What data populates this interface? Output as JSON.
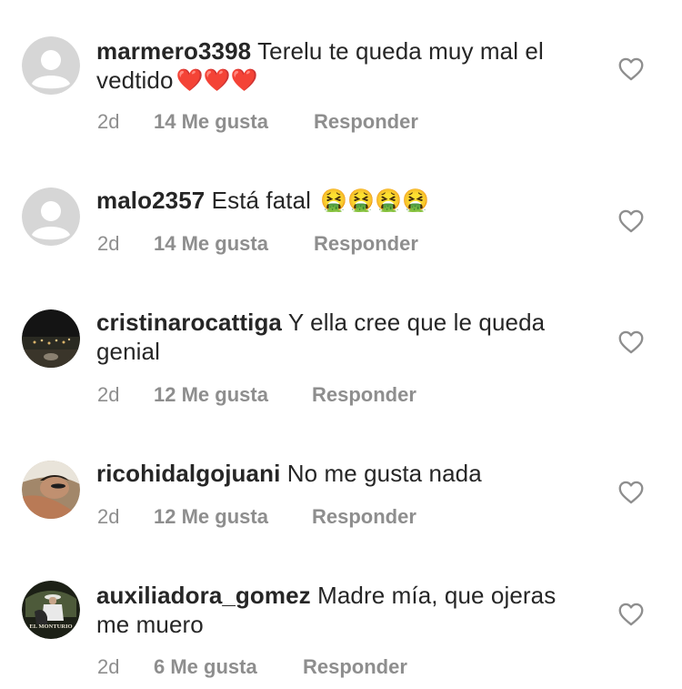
{
  "comments": [
    {
      "username": "marmero3398",
      "text": "Terelu te queda muy mal el vedtido",
      "emoji": "❤️❤️❤️",
      "time": "2d",
      "likes": "14 Me gusta",
      "reply": "Responder"
    },
    {
      "username": "malo2357",
      "text": "Está fatal",
      "emoji": "🤮🤮🤮🤮",
      "time": "2d",
      "likes": "14 Me gusta",
      "reply": "Responder"
    },
    {
      "username": "cristinarocattiga",
      "text": "Y ella cree que le queda genial",
      "emoji": "",
      "time": "2d",
      "likes": "12 Me gusta",
      "reply": "Responder"
    },
    {
      "username": "ricohidalgojuani",
      "text": "No me gusta nada",
      "emoji": "",
      "time": "2d",
      "likes": "12 Me gusta",
      "reply": "Responder"
    },
    {
      "username": "auxiliadora_gomez",
      "text": "Madre mía, que ojeras me muero",
      "emoji": "",
      "time": "2d",
      "likes": "6 Me gusta",
      "reply": "Responder"
    }
  ],
  "avatar_logo_text": "EL MONTURIO",
  "colors": {
    "text": "#262626",
    "meta": "#8e8e8e",
    "default_avatar_bg": "#d9d9d9",
    "heart_outline": "#8e8e8e"
  },
  "icons": {
    "like": "heart-outline-icon",
    "default_avatar": "default-user-avatar"
  }
}
